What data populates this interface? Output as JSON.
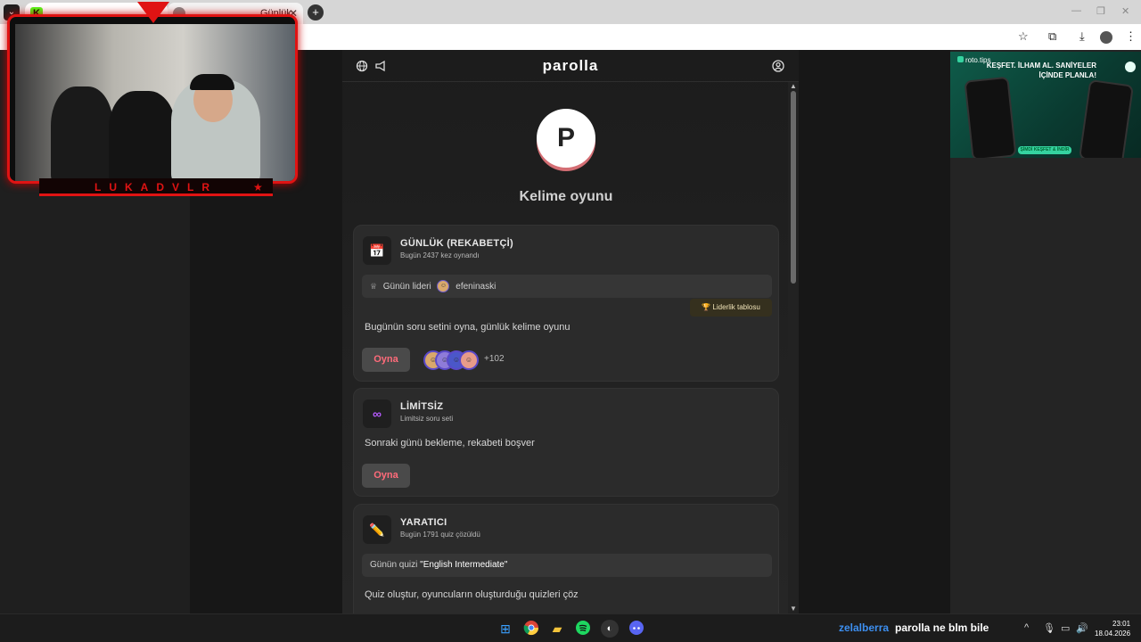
{
  "browser": {
    "tabs": [
      {
        "label": "",
        "favicon": "kick-logo",
        "active": true
      },
      {
        "label": "Günlük",
        "favicon": "globe-icon",
        "active": false
      }
    ],
    "new_tab": "+",
    "tab_close": "✕"
  },
  "webcam": {
    "streamer_name": "LUKADVLR"
  },
  "site": {
    "name": "parolla",
    "logo_letter": "P",
    "subtitle": "Kelime oyunu"
  },
  "cards": {
    "daily": {
      "icon": "calendar-icon",
      "title": "GÜNLÜK (REKABETÇİ)",
      "meta": "Bugün 2437 kez oynandı",
      "leader_label": "Günün lideri",
      "leader_name": "efeninaski",
      "leaderboard_button": "Liderlik tablosu",
      "description": "Bugünün soru setini oyna, günlük kelime oyunu",
      "play_label": "Oyna",
      "players_more": "+102"
    },
    "unlimited": {
      "icon": "infinity-icon",
      "title": "LİMİTSİZ",
      "meta": "Limitsiz soru seti",
      "description": "Sonraki günü bekleme, rekabeti boşver",
      "play_label": "Oyna"
    },
    "creator": {
      "icon": "pencil-icon",
      "title": "YARATICI",
      "meta": "Bugün 1791 quiz çözüldü",
      "quiz_label": "Günün quizi",
      "quiz_name": "\"English Intermediate\"",
      "description": "Quiz oluştur, oyuncuların oluşturduğu quizleri çöz"
    }
  },
  "ad": {
    "brand": "roto.tips",
    "headline": "KEŞFET. İLHAM AL. SANİYELER İÇİNDE PLANLA!",
    "cta": "ŞİMDİ KEŞFET & İNDİR"
  },
  "chat": {
    "user": "zelalberra",
    "message": "parolla ne blm bile"
  },
  "clock": {
    "time": "23:01",
    "date": "18.04.2026"
  },
  "colors": {
    "accent_red": "#e01313",
    "play_text": "#ff6b7a",
    "chat_user": "#3d8ff0"
  }
}
